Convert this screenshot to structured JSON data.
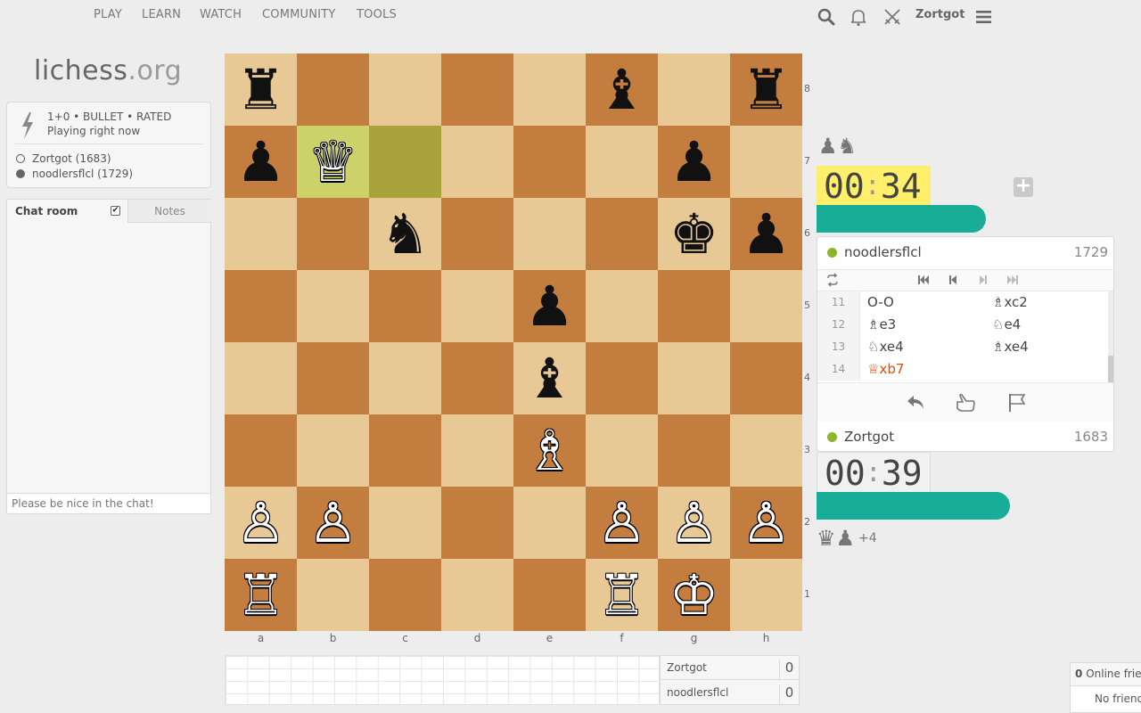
{
  "nav": {
    "items": [
      "PLAY",
      "LEARN",
      "WATCH",
      "COMMUNITY",
      "TOOLS"
    ],
    "username": "Zortgot",
    "icons": [
      "search-icon",
      "bell-icon",
      "swords-icon",
      "hamburger-menu-icon"
    ]
  },
  "logo": {
    "name": "lichess",
    "tld": ".org"
  },
  "game": {
    "setup": "1+0 • BULLET • RATED",
    "status": "Playing right now",
    "white_player": "Zortgot (1683)",
    "black_player": "noodlersflcl (1729)"
  },
  "chat": {
    "tab_chat": "Chat room",
    "tab_notes": "Notes",
    "placeholder": "Please be nice in the chat!",
    "enabled": true
  },
  "board": {
    "files": [
      "a",
      "b",
      "c",
      "d",
      "e",
      "f",
      "g",
      "h"
    ],
    "ranks": [
      "8",
      "7",
      "6",
      "5",
      "4",
      "3",
      "2",
      "1"
    ],
    "position": [
      [
        "♜",
        "",
        "",
        "",
        "",
        "♝",
        "",
        "♜"
      ],
      [
        "♟",
        "♕",
        "",
        "",
        "",
        "",
        "♟",
        ""
      ],
      [
        "",
        "",
        "♞",
        "",
        "",
        "",
        "♚",
        "♟"
      ],
      [
        "",
        "",
        "",
        "",
        "♟",
        "",
        "",
        ""
      ],
      [
        "",
        "",
        "",
        "",
        "♝",
        "",
        "",
        ""
      ],
      [
        "",
        "",
        "",
        "",
        "♗",
        "",
        "",
        ""
      ],
      [
        "♙",
        "♙",
        "",
        "",
        "",
        "♙",
        "♙",
        "♙"
      ],
      [
        "♖",
        "",
        "",
        "",
        "",
        "♖",
        "♔",
        ""
      ]
    ],
    "last_move": [
      "b7",
      "c7"
    ]
  },
  "crosstable": [
    {
      "name": "Zortgot",
      "score": "0"
    },
    {
      "name": "noodlersflcl",
      "score": "0"
    }
  ],
  "opponent": {
    "name": "noodlersflcl",
    "rating": "1729",
    "clock_min": "00",
    "clock_sec": "34",
    "captured": "♟♞",
    "bar_fraction": 0.57
  },
  "me": {
    "name": "Zortgot",
    "rating": "1683",
    "clock_min": "00",
    "clock_sec": "39",
    "captured": "♛♟",
    "material_diff": "+4",
    "bar_fraction": 0.65
  },
  "moves": [
    {
      "num": "11",
      "white": "O-O",
      "black": "♗xc2"
    },
    {
      "num": "12",
      "white": "♗e3",
      "black": "♘e4"
    },
    {
      "num": "13",
      "white": "♘xe4",
      "black": "♗xe4"
    },
    {
      "num": "14",
      "white": "♕xb7",
      "black": ""
    }
  ],
  "friends": {
    "count": "0",
    "label": "Online friends",
    "empty": "No friends online"
  },
  "colors": {
    "accent": "#17ad96",
    "clock_running": "#ffef6b",
    "online": "#8bb52b",
    "current_move": "#d85000"
  }
}
